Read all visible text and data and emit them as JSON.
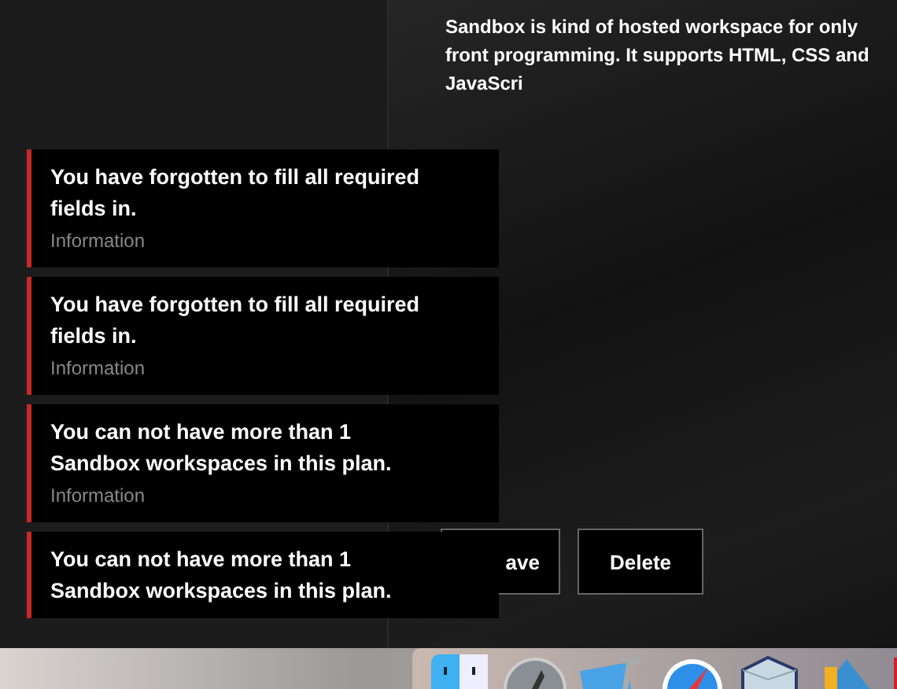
{
  "description": "Sandbox is kind of hosted workspace for only front programming. It supports HTML, CSS and JavaScri",
  "buttons": [
    {
      "label": "ave"
    },
    {
      "label": "Delete"
    }
  ],
  "toasts": [
    {
      "title": "You have forgotten to fill all required fields in.",
      "category": "Information"
    },
    {
      "title": "You have forgotten to fill all required fields in.",
      "category": "Information"
    },
    {
      "title": "You can not have more than 1 Sandbox workspaces in this plan.",
      "category": "Information"
    },
    {
      "title": "You can not have more than 1 Sandbox workspaces in this plan."
    }
  ]
}
